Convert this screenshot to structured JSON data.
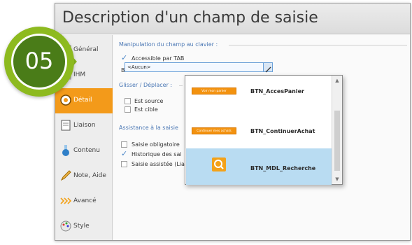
{
  "badge": {
    "label": "05"
  },
  "window": {
    "title": "Description d'un champ de saisie"
  },
  "sidebar": {
    "items": [
      {
        "label": "Général"
      },
      {
        "label": "IHM"
      },
      {
        "label": "Détail"
      },
      {
        "label": "Liaison"
      },
      {
        "label": "Contenu"
      },
      {
        "label": "Note, Aide"
      },
      {
        "label": "Avancé"
      },
      {
        "label": "Style"
      }
    ]
  },
  "keyboard": {
    "group_title": "Manipulation du champ au clavier :",
    "accessible_tab": "Accessible par TAB",
    "validation_label": "Bouton de validation :",
    "validation_value": "<Aucun>"
  },
  "dragdrop": {
    "group_title": "Glisser / Déplacer :",
    "source": "Est source",
    "target": "Est cible"
  },
  "assist": {
    "group_title": "Assistance à la saisie",
    "mandatory": "Saisie obligatoire",
    "history": "Historique des sai",
    "assisted": "Saisie assistée (Lia"
  },
  "dropdown": {
    "items": [
      {
        "button_text": "Voir mon panier",
        "name": "BTN_AccesPanier"
      },
      {
        "button_text": "Continuer mes achats",
        "name": "BTN_ContinuerAchat"
      },
      {
        "name": "BTN_MDL_Recherche"
      }
    ]
  },
  "colors": {
    "accent": "#f39a1a",
    "badge_green": "#8dba1f",
    "badge_dark": "#4a7c18",
    "link_blue": "#4a77b4",
    "selection": "#b9dcf2"
  }
}
